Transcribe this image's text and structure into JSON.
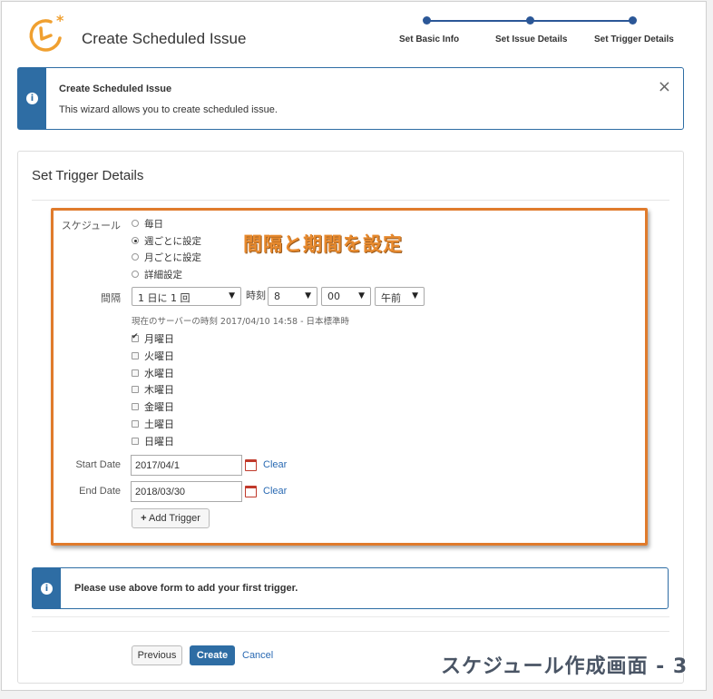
{
  "header": {
    "title": "Create Scheduled Issue",
    "steps": [
      "Set Basic Info",
      "Set Issue Details",
      "Set Trigger Details"
    ]
  },
  "info": {
    "title": "Create Scheduled Issue",
    "text": "This wizard allows you to create scheduled issue.",
    "close": "×"
  },
  "card": {
    "title": "Set Trigger Details"
  },
  "annotation": "間隔と期間を設定",
  "schedule": {
    "label": "スケジュール",
    "options": [
      "毎日",
      "週ごとに設定",
      "月ごとに設定",
      "詳細設定"
    ],
    "selected": "週ごとに設定"
  },
  "interval": {
    "label": "間隔",
    "value": "1 日に 1 回",
    "time_label": "時刻",
    "hour": "8",
    "minute": "00",
    "ampm": "午前"
  },
  "server_time": "現在のサーバーの時刻 2017/04/10 14:58 - 日本標準時",
  "days": [
    {
      "label": "月曜日",
      "checked": true
    },
    {
      "label": "火曜日",
      "checked": false
    },
    {
      "label": "水曜日",
      "checked": false
    },
    {
      "label": "木曜日",
      "checked": false
    },
    {
      "label": "金曜日",
      "checked": false
    },
    {
      "label": "土曜日",
      "checked": false
    },
    {
      "label": "日曜日",
      "checked": false
    }
  ],
  "start_date": {
    "label": "Start Date",
    "value": "2017/04/1",
    "clear": "Clear"
  },
  "end_date": {
    "label": "End Date",
    "value": "2018/03/30",
    "clear": "Clear"
  },
  "add_trigger": "Add Trigger",
  "trigger_notice": "Please use above form to add your first trigger.",
  "footer": {
    "previous": "Previous",
    "create": "Create",
    "cancel": "Cancel"
  },
  "caption": "スケジュール作成画面 - 3",
  "colors": {
    "accent": "#2e6da4",
    "highlight": "#e07b2c",
    "annotation": "#e88a2e",
    "link": "#2a6ab3"
  }
}
